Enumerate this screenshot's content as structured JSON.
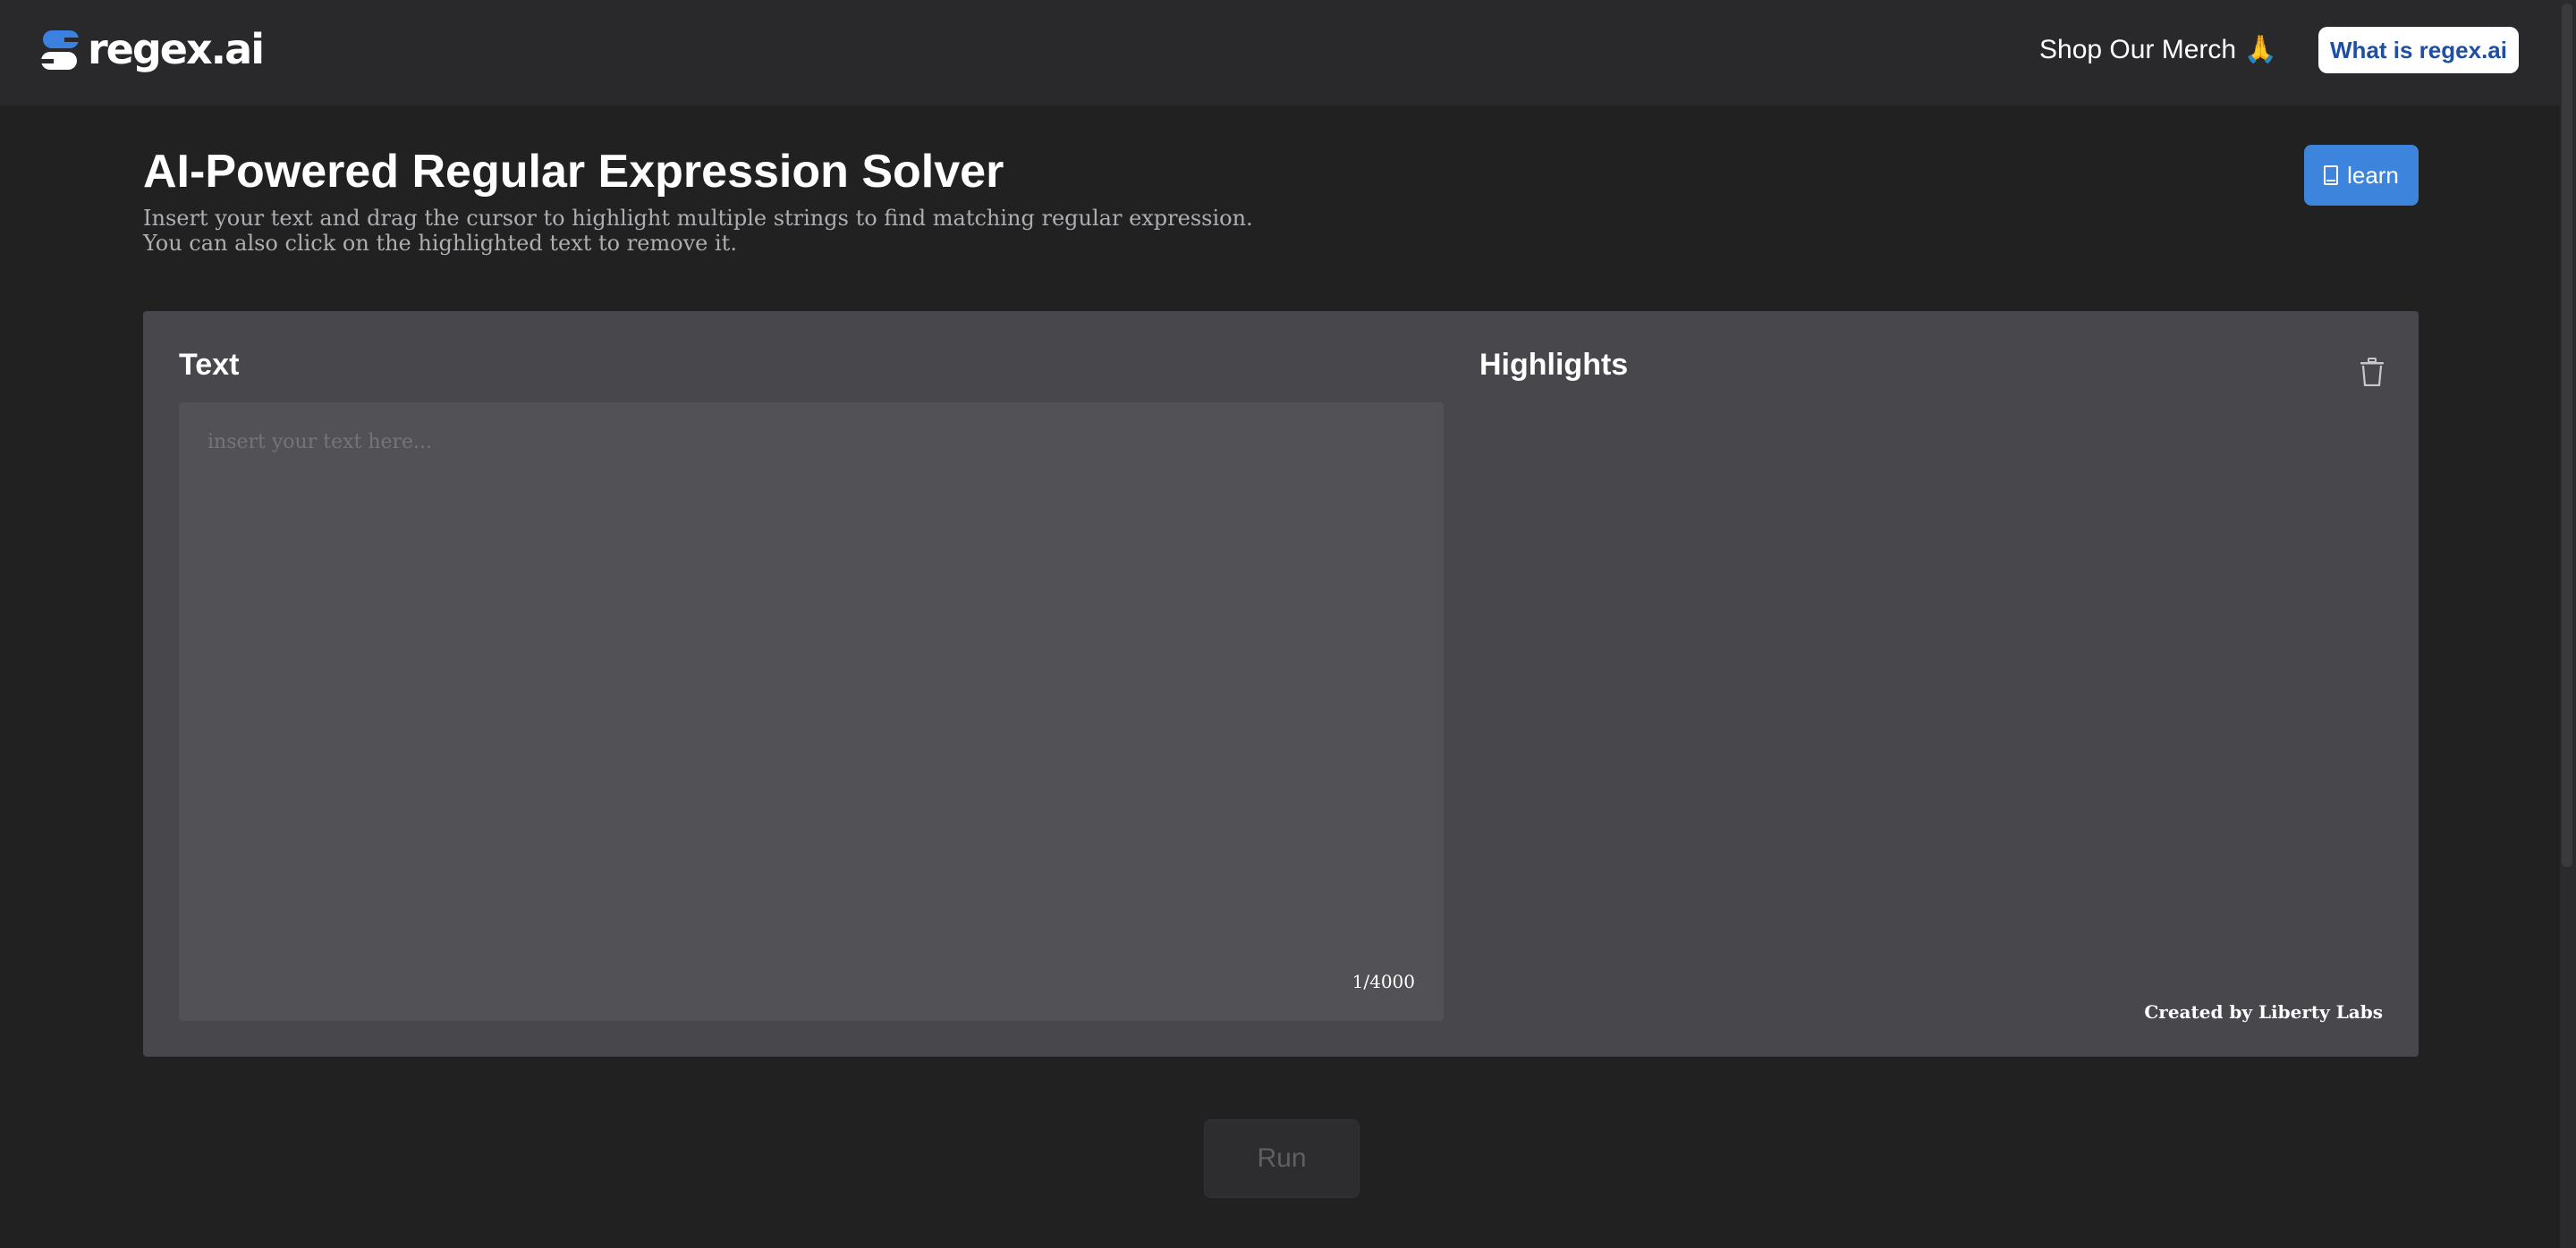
{
  "header": {
    "logo_text": "regex.ai",
    "merch_label": "Shop Our Merch",
    "merch_emoji": "🙏",
    "what_is_label": "What is regex.ai"
  },
  "main": {
    "title": "AI-Powered Regular Expression Solver",
    "description_line1": "Insert your text and drag the cursor to highlight multiple strings to find matching regular expression.",
    "description_line2": "You can also click on the highlighted text to remove it.",
    "learn_label": "learn"
  },
  "editor": {
    "text_heading": "Text",
    "placeholder": "insert your text here...",
    "value": "",
    "char_count": "1/4000",
    "highlights_heading": "Highlights",
    "credit": "Created by Liberty Labs"
  },
  "actions": {
    "run_label": "Run"
  },
  "colors": {
    "accent": "#3d84dc",
    "background": "#212122",
    "header_bg": "#29292c",
    "panel_bg": "#47474c",
    "textarea_bg": "#525256"
  },
  "icons": {
    "learn": "book-icon",
    "clear_highlights": "trash-icon"
  }
}
